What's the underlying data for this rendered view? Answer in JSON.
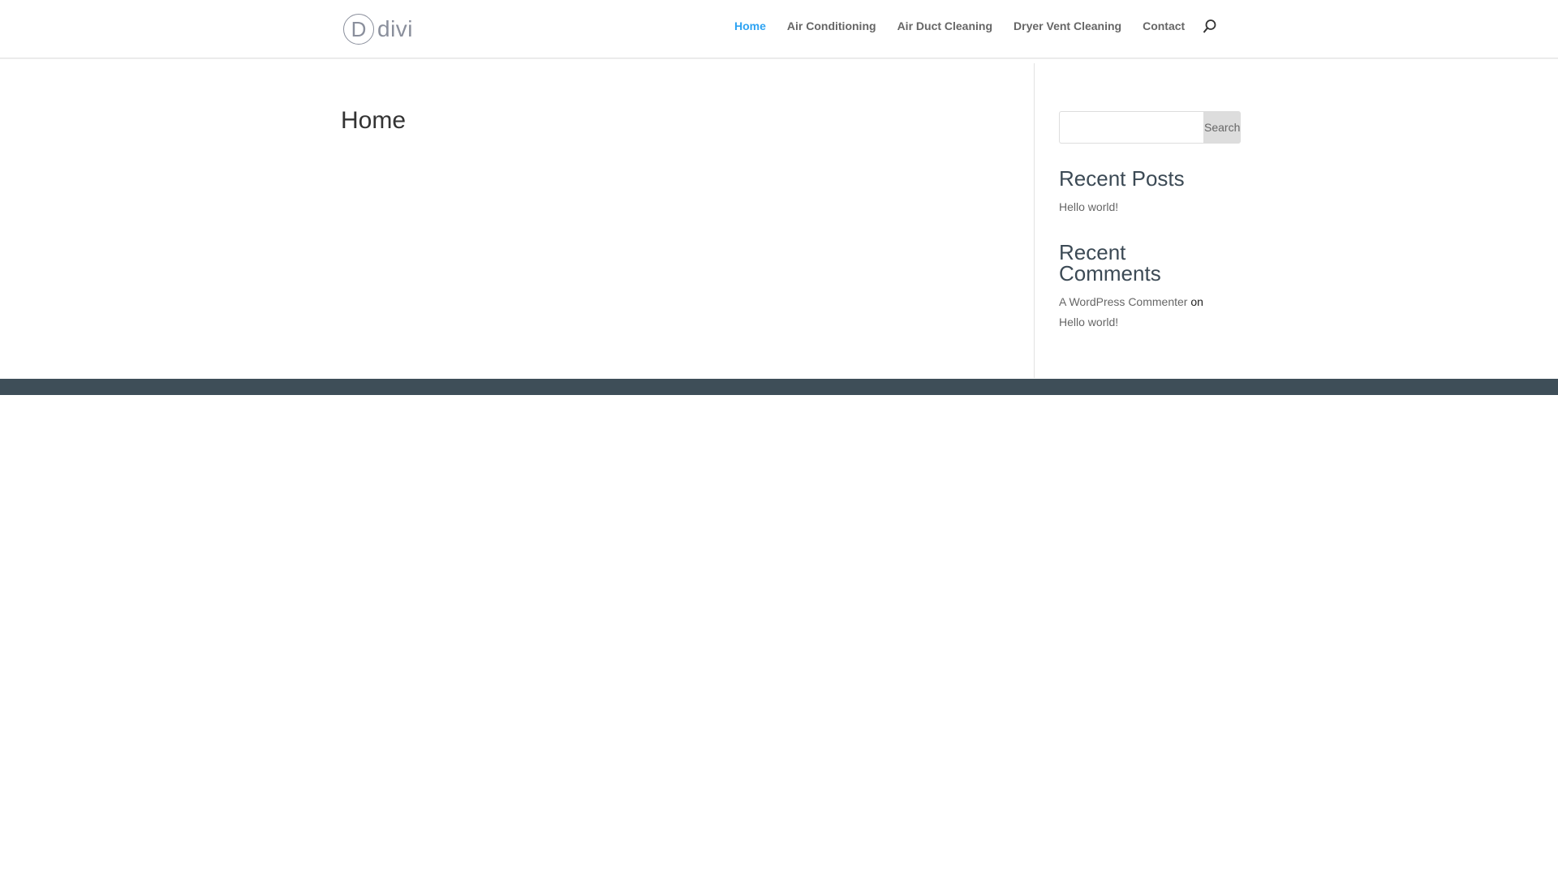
{
  "header": {
    "logo_text": "divi",
    "logo_letter": "D",
    "nav": [
      {
        "label": "Home",
        "active": true
      },
      {
        "label": "Air Conditioning"
      },
      {
        "label": "Air Duct Cleaning"
      },
      {
        "label": "Dryer Vent Cleaning"
      },
      {
        "label": "Contact"
      }
    ]
  },
  "main": {
    "title": "Home"
  },
  "sidebar": {
    "search": {
      "placeholder": "",
      "button": "Search"
    },
    "recent_posts": {
      "title": "Recent Posts",
      "items": [
        "Hello world!"
      ]
    },
    "recent_comments": {
      "title": "Recent Comments",
      "author": "A WordPress Commenter",
      "on": "on",
      "post": "Hello world!"
    }
  },
  "colors": {
    "accent": "#2ea3f2",
    "footer": "#3e4e58"
  }
}
